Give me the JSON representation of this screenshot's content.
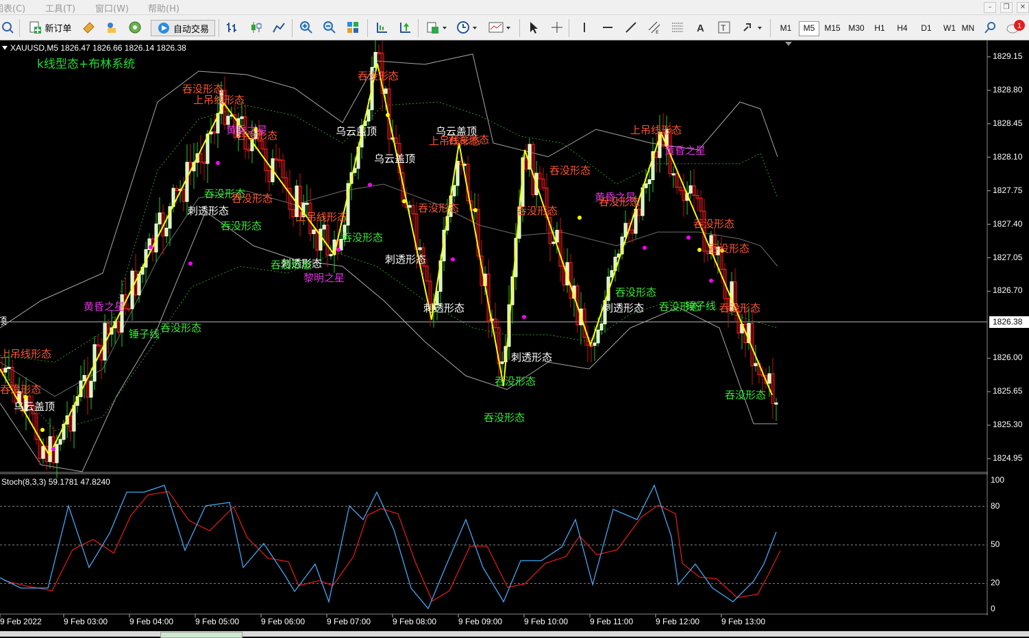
{
  "menubar": {
    "items": [
      "图表(C)",
      "工具(T)",
      "窗口(W)",
      "帮助(H)"
    ]
  },
  "toolbar": {
    "new_order_label": "新订单",
    "auto_trade_label": "自动交易",
    "timeframes": [
      "M1",
      "M5",
      "M15",
      "M30",
      "H1",
      "H4",
      "D1",
      "W1",
      "MN"
    ],
    "active_timeframe": "M5",
    "alert_count": "1"
  },
  "main_chart": {
    "symbol_header": "XAUUSD,M5  1826.47 1826.66 1826.14 1826.38",
    "indicator_title": "k线型态+布林系统",
    "current_price": "1826.38",
    "price_ticks": [
      "1829.15",
      "1828.80",
      "1828.45",
      "1828.10",
      "1827.75",
      "1827.40",
      "1827.05",
      "1826.70",
      "1826.38",
      "1826.00",
      "1825.65",
      "1825.30",
      "1824.95"
    ],
    "colors": {
      "bull_candle": "#ccffaa",
      "bear_candle": "#ff2222",
      "zigzag": "#ffff00",
      "bollinger": "#a9a9a9",
      "bearish_label": "#ff5533",
      "bullish_label": "#33ee33",
      "neutral_label": "#ffffff",
      "star_label": "#dd33dd"
    }
  },
  "patterns": [
    {
      "text": "吞没形态",
      "kind": "bear"
    },
    {
      "text": "上吊线形态",
      "kind": "bear"
    },
    {
      "text": "黄昏之星",
      "kind": "star"
    },
    {
      "text": "吞没形态",
      "kind": "bear"
    },
    {
      "text": "吞没形态",
      "kind": "bull"
    },
    {
      "text": "刺透形态",
      "kind": "neutral"
    },
    {
      "text": "吞没形态",
      "kind": "bull"
    },
    {
      "text": "吞没形态",
      "kind": "bear"
    },
    {
      "text": "上吊线形态",
      "kind": "bear"
    },
    {
      "text": "吞没形态",
      "kind": "bull"
    },
    {
      "text": "刺透形态",
      "kind": "neutral"
    },
    {
      "text": "黎明之星",
      "kind": "star"
    },
    {
      "text": "吞没形态",
      "kind": "bear"
    },
    {
      "text": "乌云盖顶",
      "kind": "neutral"
    },
    {
      "text": "乌云盖顶",
      "kind": "neutral"
    },
    {
      "text": "吞没形态",
      "kind": "bull"
    },
    {
      "text": "刺透形态",
      "kind": "neutral"
    },
    {
      "text": "吞没形态",
      "kind": "bear"
    },
    {
      "text": "刺透形态",
      "kind": "neutral"
    },
    {
      "text": "乌云盖顶",
      "kind": "neutral"
    },
    {
      "text": "上吊线形态",
      "kind": "bear"
    },
    {
      "text": "吞没形态",
      "kind": "bear"
    },
    {
      "text": "吞没形态",
      "kind": "bear"
    },
    {
      "text": "刺透形态",
      "kind": "neutral"
    },
    {
      "text": "吞没形态",
      "kind": "bull"
    },
    {
      "text": "吞没形态",
      "kind": "bull"
    },
    {
      "text": "吞没形态",
      "kind": "bear"
    },
    {
      "text": "黄昏之星",
      "kind": "star"
    },
    {
      "text": "刺透形态",
      "kind": "neutral"
    },
    {
      "text": "吞没形态",
      "kind": "bull"
    },
    {
      "text": "上吊线形态",
      "kind": "bear"
    },
    {
      "text": "黄昏之星",
      "kind": "star"
    },
    {
      "text": "吞没形态",
      "kind": "bear"
    },
    {
      "text": "吞没形态",
      "kind": "bear"
    },
    {
      "text": "吞没形态",
      "kind": "bull"
    },
    {
      "text": "锤子线",
      "kind": "bull"
    },
    {
      "text": "吞没形态",
      "kind": "bear"
    },
    {
      "text": "吞没形态",
      "kind": "bull"
    },
    {
      "text": "吞没形态",
      "kind": "bear"
    },
    {
      "text": "上吊线形态",
      "kind": "bear"
    },
    {
      "text": "乌云盖顶",
      "kind": "neutral"
    },
    {
      "text": "吞没形态",
      "kind": "bear"
    },
    {
      "text": "黄昏之星",
      "kind": "star"
    },
    {
      "text": "锤子线",
      "kind": "bull"
    },
    {
      "text": "吞没形态",
      "kind": "bull"
    }
  ],
  "stochastic": {
    "header": "Stoch(8,3,3) 59.1781 47.8240",
    "ticks": [
      "100",
      "80",
      "50",
      "20",
      "0"
    ],
    "colors": {
      "main": "#3fa9f5",
      "signal": "#e01818"
    }
  },
  "time_axis": {
    "labels": [
      "9 Feb 2022",
      "9 Feb 03:00",
      "9 Feb 04:00",
      "9 Feb 05:00",
      "9 Feb 06:00",
      "9 Feb 07:00",
      "9 Feb 08:00",
      "9 Feb 09:00",
      "9 Feb 10:00",
      "9 Feb 11:00",
      "9 Feb 12:00",
      "9 Feb 13:00"
    ]
  }
}
